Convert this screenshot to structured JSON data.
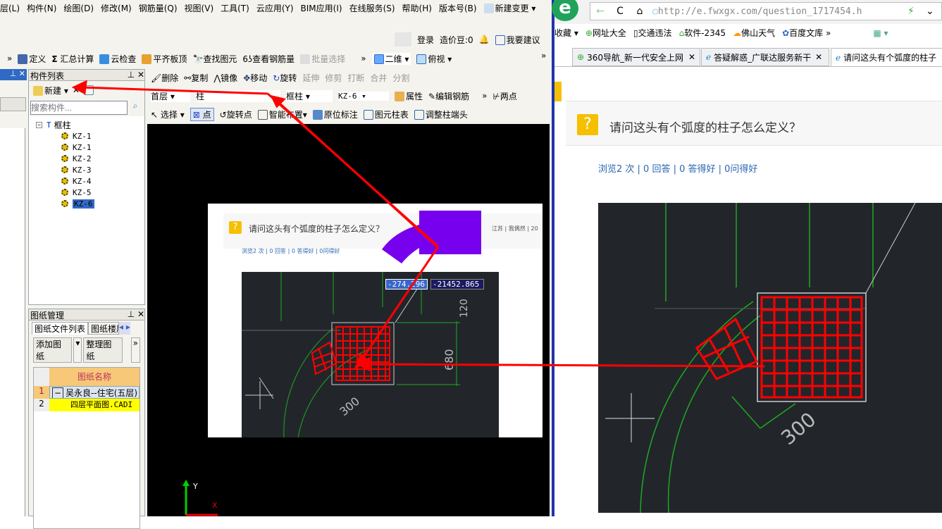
{
  "app": {
    "menu": [
      "层(L)",
      "构件(N)",
      "绘图(D)",
      "修改(M)",
      "钢筋量(Q)",
      "视图(V)",
      "工具(T)",
      "云应用(Y)",
      "BIM应用(I)",
      "在线服务(S)",
      "帮助(H)",
      "版本号(B)",
      "新建变更"
    ],
    "login": {
      "login": "登录",
      "beans": "造价豆:0",
      "suggest": "我要建议"
    },
    "toolbar1": [
      "定义",
      "汇总计算",
      "云检查",
      "平齐板顶",
      "查找图元",
      "查看钢筋量",
      "批量选择"
    ],
    "view": {
      "mode": "二维",
      "angle": "俯视"
    },
    "toolbar2": [
      "删除",
      "复制",
      "镜像",
      "移动",
      "旋转",
      "延伸",
      "修剪",
      "打断",
      "合并",
      "分割"
    ],
    "toolbar3": {
      "floor": "首层",
      "type": "柱",
      "subtype": "框柱",
      "name": "KZ-6",
      "props": "属性",
      "edit_rebar": "编辑钢筋",
      "two_point": "两点"
    },
    "toolbar4": [
      "选择",
      "点",
      "旋转点",
      "智能布置",
      "原位标注",
      "图元柱表",
      "调整柱端头"
    ],
    "component_list": {
      "title": "构件列表",
      "new": "新建",
      "search_placeholder": "搜索构件...",
      "root": "框柱",
      "items": [
        "KZ-1",
        "KZ-1",
        "KZ-2",
        "KZ-3",
        "KZ-4",
        "KZ-5",
        "KZ-6"
      ],
      "selected": "KZ-6"
    },
    "drawing_mgmt": {
      "title": "图纸管理",
      "tabs": [
        "图纸文件列表",
        "图纸楼层"
      ],
      "add": "添加图纸",
      "organize": "整理图纸",
      "column": "图纸名称",
      "rows": [
        {
          "no": "1",
          "name": "吴永良--住宅(五层)"
        },
        {
          "no": "2",
          "name": "四层平面图.CADI"
        }
      ]
    },
    "coords": {
      "x": "-274.296",
      "y": "-21452.865"
    },
    "axis": {
      "x": "X",
      "y": "Y"
    }
  },
  "embedded": {
    "title": "请问这头有个弧度的柱子怎么定义？",
    "meta": "江苏 | 我偶然 | 20",
    "stats": "浏览2 次 | 0 回答 | 0 答得好 | 0问得好",
    "dims": [
      "120",
      "680",
      "300"
    ]
  },
  "browser": {
    "url": "http://e.fwxgx.com/question_1717454.h",
    "bookmarks": [
      "收藏",
      "网址大全",
      "交通违法",
      "软件-2345",
      "佛山天气",
      "百度文库"
    ],
    "tabs": [
      "360导航_新一代安全上网",
      "答疑解惑_广联达服务新干",
      "请问这头有个弧度的柱子"
    ],
    "question": "请问这头有个弧度的柱子怎么定义？",
    "stats": "浏览2 次 | 0 回答 | 0 答得好 | 0问得好",
    "dim": "300"
  },
  "colors": {
    "annotation": "#ff0000",
    "highlight": "#7700ee",
    "selected": "#316ac5",
    "cad_bg": "#22262b"
  }
}
